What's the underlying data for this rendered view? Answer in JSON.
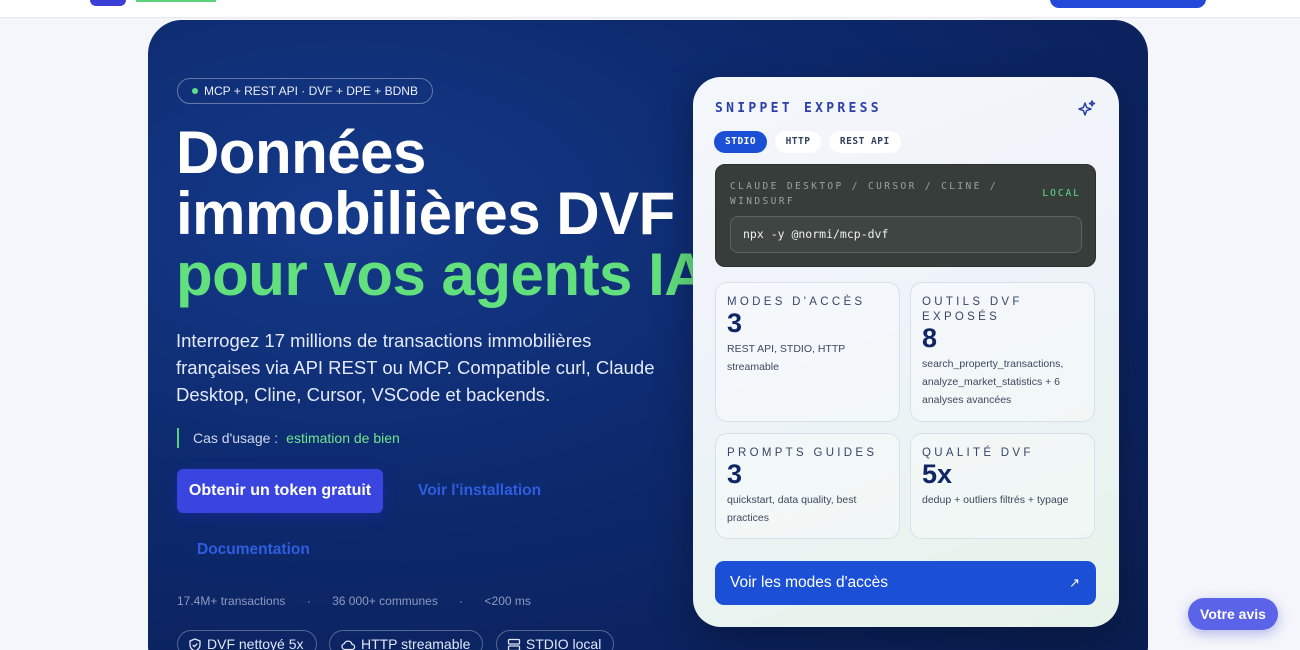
{
  "hero": {
    "badge": "MCP + REST API · DVF + DPE + BDNB",
    "title_line1": "Données",
    "title_line2": "immobilières DVF",
    "title_line3": "pour vos agents IA",
    "lead": "Interrogez 17 millions de transactions immobilières françaises via API REST ou MCP. Compatible curl, Claude Desktop, Cline, Cursor, VSCode et backends.",
    "usecase_label": "Cas d'usage :",
    "usecase_value": "estimation de bien",
    "cta_primary": "Obtenir un token gratuit",
    "link_install": "Voir l'installation",
    "link_docs": "Documentation",
    "stats": [
      "17.4M+ transactions",
      "36 000+ communes",
      "<200 ms"
    ],
    "stats_sep": "·",
    "chips": [
      {
        "icon": "shield-check-icon",
        "label": "DVF nettoyé 5x"
      },
      {
        "icon": "cloud-icon",
        "label": "HTTP streamable"
      },
      {
        "icon": "server-icon",
        "label": "STDIO local"
      }
    ]
  },
  "card": {
    "kicker": "SNIPPET EXPRESS",
    "tabs": [
      {
        "label": "STDIO",
        "active": true
      },
      {
        "label": "HTTP",
        "active": false
      },
      {
        "label": "REST API",
        "active": false
      }
    ],
    "terminal": {
      "clients": "CLAUDE DESKTOP / CURSOR / CLINE / WINDSURF",
      "mode": "LOCAL",
      "command": "npx -y @normi/mcp-dvf"
    },
    "metrics": [
      {
        "title": "MODES D'ACCÈS",
        "value": "3",
        "desc": "REST API, STDIO, HTTP streamable"
      },
      {
        "title": "OUTILS DVF EXPOSÉS",
        "value": "8",
        "desc": "search_property_transactions, analyze_market_statistics + 6 analyses avancées"
      },
      {
        "title": "PROMPTS GUIDES",
        "value": "3",
        "desc": "quickstart, data quality, best practices"
      },
      {
        "title": "QUALITÉ DVF",
        "value": "5x",
        "desc": "dedup + outliers filtrés + typage"
      }
    ],
    "button": "Voir les modes d'accès",
    "button_arrow": "↗"
  },
  "feedback": "Votre avis",
  "colors": {
    "hero_bg": "#0e2c72",
    "accent_green": "#63e07e",
    "primary_blue": "#1a4fd6",
    "cta_indigo": "#3a45e0"
  }
}
